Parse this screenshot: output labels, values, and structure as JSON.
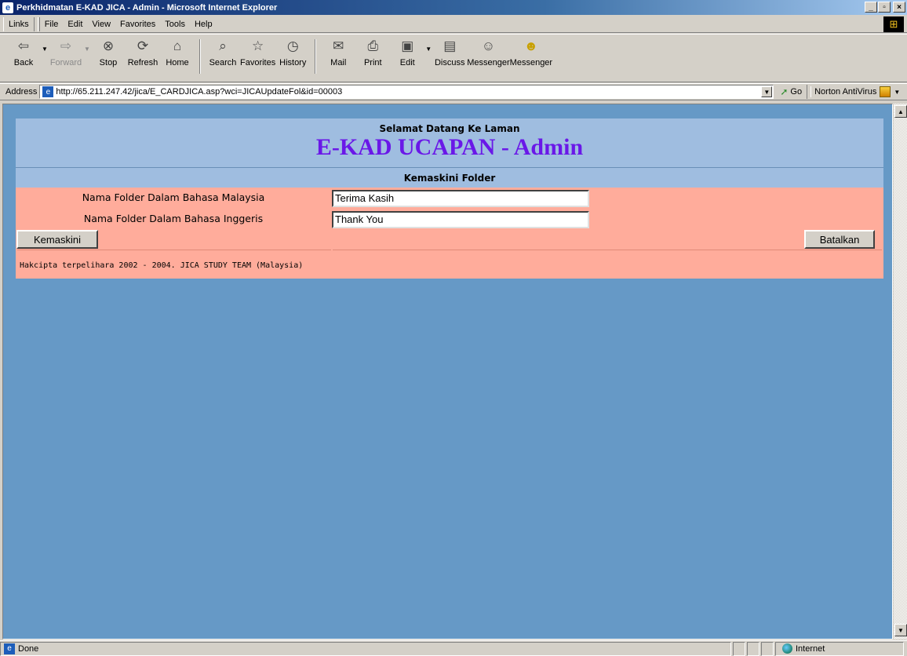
{
  "window": {
    "title": "Perkhidmatan E-KAD JICA - Admin - Microsoft Internet Explorer",
    "controls": [
      "_",
      "▫",
      "×"
    ]
  },
  "menubar": {
    "links_label": "Links",
    "items": [
      "File",
      "Edit",
      "View",
      "Favorites",
      "Tools",
      "Help"
    ]
  },
  "toolbar": {
    "buttons": [
      {
        "label": "Back",
        "icon": "back-arrow-icon"
      },
      {
        "label": "Forward",
        "icon": "forward-arrow-icon"
      },
      {
        "label": "Stop",
        "icon": "stop-icon"
      },
      {
        "label": "Refresh",
        "icon": "refresh-icon"
      },
      {
        "label": "Home",
        "icon": "home-icon"
      },
      {
        "label": "Search",
        "icon": "search-icon"
      },
      {
        "label": "Favorites",
        "icon": "favorites-icon"
      },
      {
        "label": "History",
        "icon": "history-icon"
      },
      {
        "label": "Mail",
        "icon": "mail-icon"
      },
      {
        "label": "Print",
        "icon": "print-icon"
      },
      {
        "label": "Edit",
        "icon": "edit-icon"
      },
      {
        "label": "Discuss",
        "icon": "discuss-icon"
      },
      {
        "label": "Messenger",
        "icon": "messenger-icon"
      },
      {
        "label": "Messenger",
        "icon": "messenger-alt-icon"
      }
    ]
  },
  "addressbar": {
    "label": "Address",
    "url": "http://65.211.247.42/jica/E_CARDJICA.asp?wci=JICAUpdateFol&id=00003",
    "go_label": "Go",
    "norton_label": "Norton AntiVirus"
  },
  "page": {
    "welcome": "Selamat Datang Ke Laman",
    "app_title": "E-KAD UCAPAN - Admin",
    "section_title": "Kemaskini Folder",
    "fields": [
      {
        "label": "Nama Folder Dalam Bahasa Malaysia",
        "value": "Terima Kasih"
      },
      {
        "label": "Nama Folder Dalam Bahasa Inggeris",
        "value": "Thank You"
      }
    ],
    "update_button": "Kemaskini",
    "cancel_button": "Batalkan",
    "copyright": "Hakcipta terpelihara 2002 - 2004. JICA STUDY TEAM (Malaysia)"
  },
  "statusbar": {
    "status": "Done",
    "zone": "Internet"
  },
  "colors": {
    "viewport_bg": "#6699c6",
    "header_bg": "#9fbde0",
    "title_color": "#6a18e8",
    "form_bg": "#ffac9b"
  }
}
